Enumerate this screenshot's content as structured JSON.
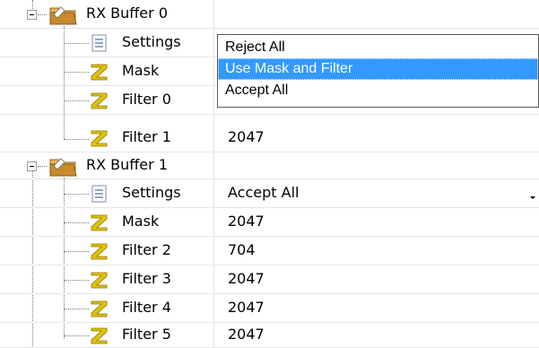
{
  "tree": {
    "groups": [
      {
        "label": "RX Buffer 0",
        "items": [
          {
            "label": "Settings",
            "value": "",
            "icon": "settings-page-icon"
          },
          {
            "label": "Mask",
            "value": "",
            "icon": "z-value-icon"
          },
          {
            "label": "Filter 0",
            "value": "",
            "icon": "z-value-icon"
          },
          {
            "label": "Filter 1",
            "value": "2047",
            "icon": "z-value-icon"
          }
        ]
      },
      {
        "label": "RX Buffer 1",
        "items": [
          {
            "label": "Settings",
            "value": "Accept All",
            "icon": "settings-page-icon"
          },
          {
            "label": "Mask",
            "value": "2047",
            "icon": "z-value-icon"
          },
          {
            "label": "Filter 2",
            "value": "704",
            "icon": "z-value-icon"
          },
          {
            "label": "Filter 3",
            "value": "2047",
            "icon": "z-value-icon"
          },
          {
            "label": "Filter 4",
            "value": "2047",
            "icon": "z-value-icon"
          },
          {
            "label": "Filter 5",
            "value": "2047",
            "icon": "z-value-icon"
          }
        ]
      }
    ]
  },
  "dropdown": {
    "options": [
      "Reject All",
      "Use Mask and Filter",
      "Accept All"
    ],
    "selected_index": 1
  },
  "colors": {
    "selection": "#3399ff",
    "grid_line": "#e6e6e6",
    "icon_z": "#d8b400",
    "folder": "#c98b2b"
  }
}
